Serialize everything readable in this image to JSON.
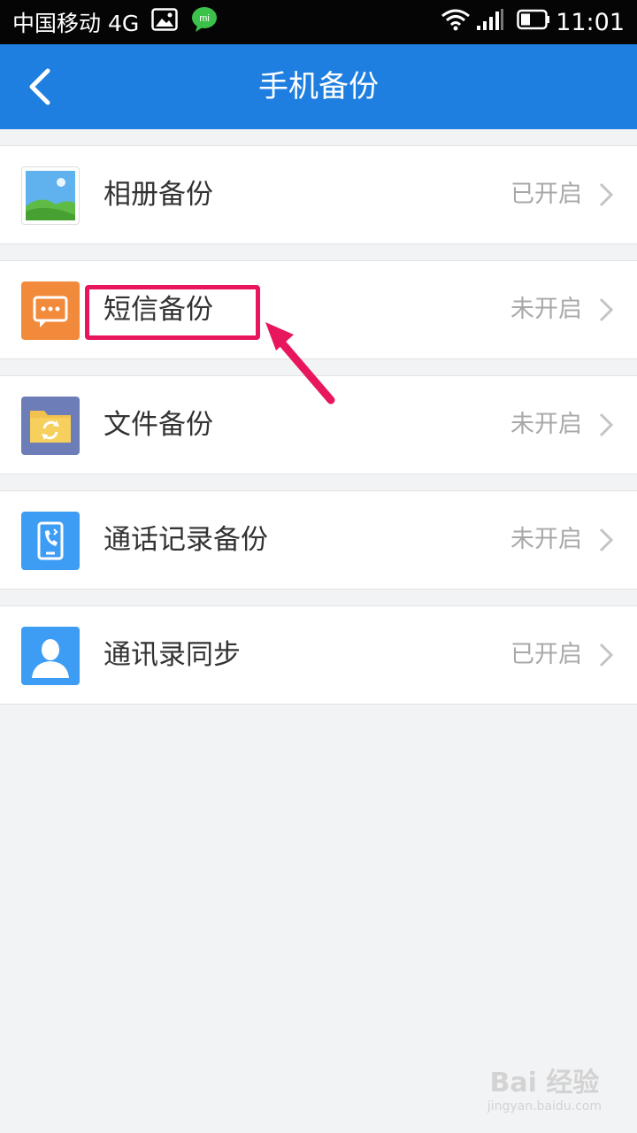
{
  "status_bar": {
    "carrier": "中国移动 4G",
    "time": "11:01",
    "mi_icon_text": "mi"
  },
  "header": {
    "title": "手机备份"
  },
  "items": [
    {
      "label": "相册备份",
      "status": "已开启",
      "icon": "photo-icon"
    },
    {
      "label": "短信备份",
      "status": "未开启",
      "icon": "sms-icon"
    },
    {
      "label": "文件备份",
      "status": "未开启",
      "icon": "folder-sync-icon"
    },
    {
      "label": "通话记录备份",
      "status": "未开启",
      "icon": "call-log-icon"
    },
    {
      "label": "通讯录同步",
      "status": "已开启",
      "icon": "contacts-icon"
    }
  ],
  "watermark": {
    "top": "Bai 经验",
    "bottom": "jingyan.baidu.com"
  },
  "colors": {
    "header_blue": "#1f7fe0",
    "highlight_pink": "#e8175d",
    "sms_orange": "#f28a3c",
    "folder_purple": "#6c7db8",
    "blue_icon": "#3d9df5"
  }
}
